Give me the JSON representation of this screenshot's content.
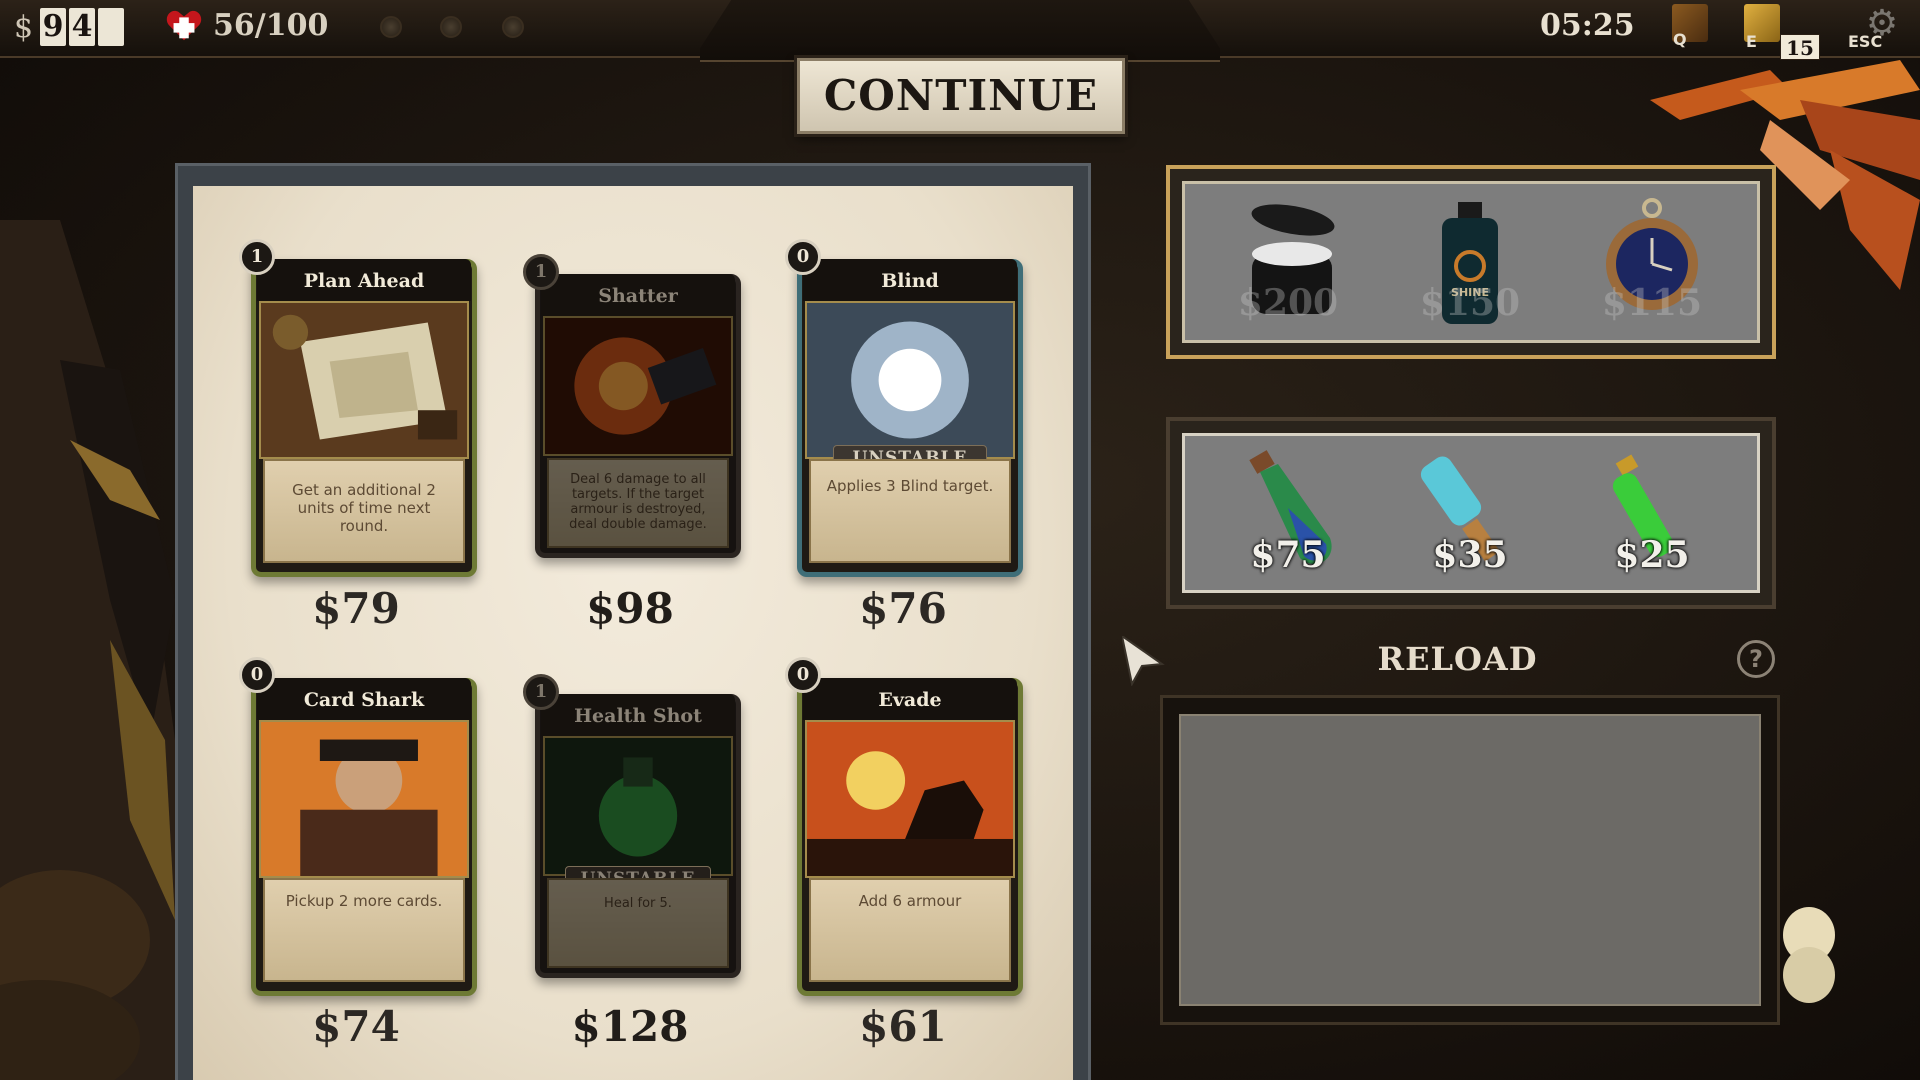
{
  "hud": {
    "currency_symbol": "$",
    "money_digits": [
      "9",
      "4",
      ""
    ],
    "health": "56/100",
    "time": "05:25",
    "hotkey_q": "Q",
    "hotkey_e": "E",
    "deck_count_digits": [
      "1",
      "5"
    ],
    "hotkey_esc": "ESC"
  },
  "continue_label": "CONTINUE",
  "cards": [
    {
      "name": "Plan Ahead",
      "cost": "1",
      "text": "Get an additional 2 units of time next round.",
      "tag": "",
      "price": "$79",
      "available": true,
      "frame": "green",
      "art": "map"
    },
    {
      "name": "Shatter",
      "cost": "1",
      "text": "Deal 6 damage to all targets. If the target armour is destroyed, deal double damage.",
      "tag": "",
      "price": "$98",
      "available": false,
      "frame": "dark",
      "art": "explosion"
    },
    {
      "name": "Blind",
      "cost": "0",
      "text": "Applies 3 Blind target.",
      "tag": "UNSTABLE",
      "price": "$76",
      "available": true,
      "frame": "blue",
      "art": "flash"
    },
    {
      "name": "Card Shark",
      "cost": "0",
      "text": "Pickup 2 more cards.",
      "tag": "",
      "price": "$74",
      "available": true,
      "frame": "green",
      "art": "gambler"
    },
    {
      "name": "Health Shot",
      "cost": "1",
      "text": "Heal for 5.",
      "tag": "UNSTABLE",
      "price": "$128",
      "available": false,
      "frame": "dark",
      "art": "potion"
    },
    {
      "name": "Evade",
      "cost": "0",
      "text": "Add 6 armour",
      "tag": "",
      "price": "$61",
      "available": true,
      "frame": "green",
      "art": "rider"
    }
  ],
  "relics": [
    {
      "icon": "tin-can-icon",
      "price": "$200"
    },
    {
      "icon": "shine-bottle-icon",
      "price": "$150",
      "label": "SHINE"
    },
    {
      "icon": "pocket-watch-icon",
      "price": "$115"
    }
  ],
  "consumables": [
    {
      "icon": "blue-green-flask-icon",
      "price": "$75"
    },
    {
      "icon": "cyan-vial-icon",
      "price": "$35"
    },
    {
      "icon": "green-tube-icon",
      "price": "$25"
    }
  ],
  "reload_label": "RELOAD",
  "help_label": "?",
  "colors": {
    "frame_green": "#6e7a35",
    "frame_blue": "#3f6e78",
    "gold_border": "#c9a25a",
    "parchment": "#efe6d4"
  }
}
